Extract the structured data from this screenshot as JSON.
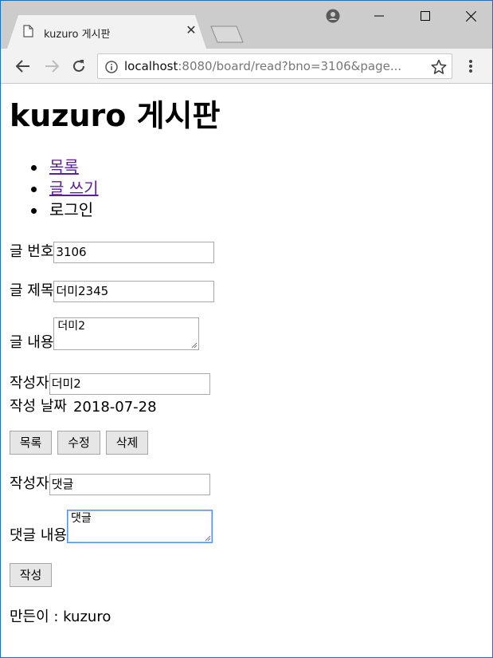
{
  "browser": {
    "tab_title": "kuzuro 게시판",
    "url_host": "localhost",
    "url_rest": ":8080/board/read?bno=3106&page..."
  },
  "header": {
    "title": "kuzuro 게시판"
  },
  "nav": {
    "items": [
      {
        "label": "목록",
        "link": true
      },
      {
        "label": "글 쓰기",
        "link": true
      },
      {
        "label": "로그인",
        "link": false
      }
    ]
  },
  "post": {
    "bno_label": "글 번호",
    "bno_value": "3106",
    "title_label": "글 제목",
    "title_value": "더미2345",
    "content_label": "글 내용",
    "content_value": "더미2",
    "writer_label": "작성자",
    "writer_value": "더미2",
    "date_label": "작성 날짜",
    "date_value": "2018-07-28"
  },
  "actions": {
    "list_label": "목록",
    "modify_label": "수정",
    "delete_label": "삭제"
  },
  "reply": {
    "writer_label": "작성자",
    "writer_value": "댓글",
    "content_label": "댓글 내용",
    "content_value": "댓글",
    "submit_label": "작성"
  },
  "footer": {
    "text": "만든이 : kuzuro"
  },
  "colors": {
    "visited_link": "#5a1f9a",
    "focus_border": "#4d90fe",
    "window_border": "#1e6fbf"
  }
}
